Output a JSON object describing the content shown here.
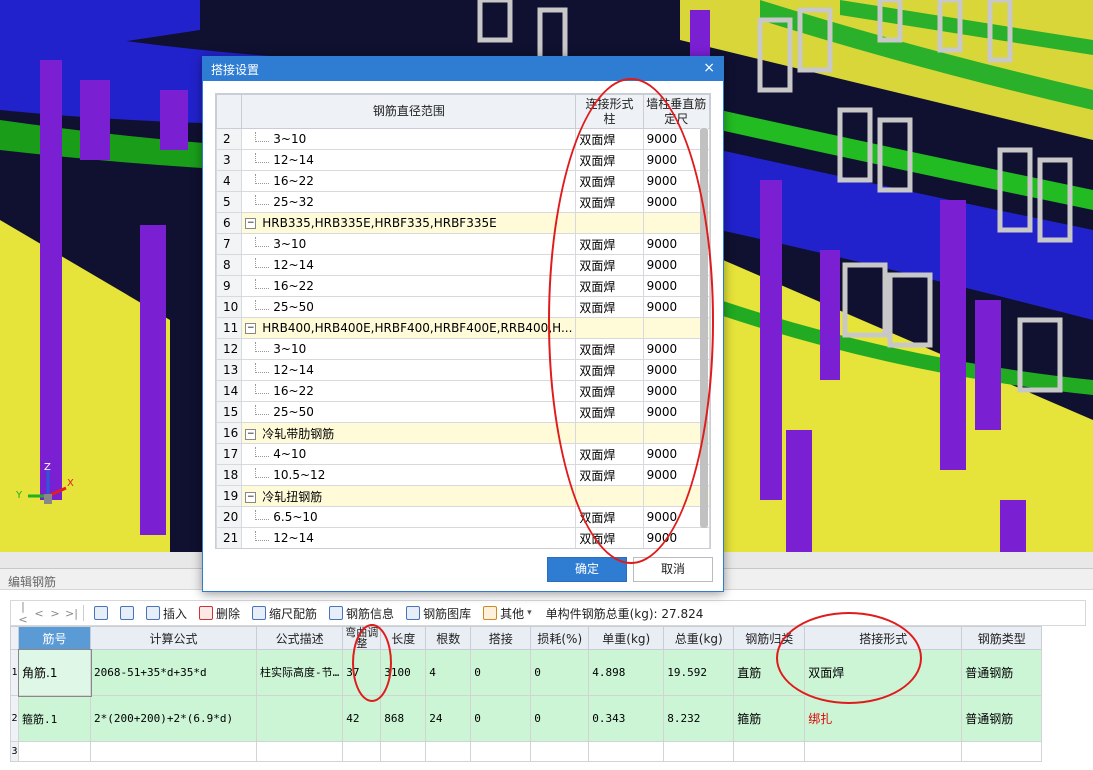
{
  "dialog": {
    "title": "搭接设置",
    "close_glyph": "×",
    "headers": {
      "range": "钢筋直径范围",
      "connection": "连接形式\n柱",
      "fixed_length": "墙柱垂直筋\n定尺"
    },
    "rows": [
      {
        "no": "2",
        "range": "3~10",
        "type": "child",
        "connection": "双面焊",
        "length": "9000"
      },
      {
        "no": "3",
        "range": "12~14",
        "type": "child",
        "connection": "双面焊",
        "length": "9000"
      },
      {
        "no": "4",
        "range": "16~22",
        "type": "child",
        "connection": "双面焊",
        "length": "9000"
      },
      {
        "no": "5",
        "range": "25~32",
        "type": "child",
        "connection": "双面焊",
        "length": "9000"
      },
      {
        "no": "6",
        "range": "HRB335,HRB335E,HRBF335,HRBF335E",
        "type": "group",
        "connection": "",
        "length": ""
      },
      {
        "no": "7",
        "range": "3~10",
        "type": "child",
        "connection": "双面焊",
        "length": "9000"
      },
      {
        "no": "8",
        "range": "12~14",
        "type": "child",
        "connection": "双面焊",
        "length": "9000"
      },
      {
        "no": "9",
        "range": "16~22",
        "type": "child",
        "connection": "双面焊",
        "length": "9000"
      },
      {
        "no": "10",
        "range": "25~50",
        "type": "child",
        "connection": "双面焊",
        "length": "9000"
      },
      {
        "no": "11",
        "range": "HRB400,HRB400E,HRBF400,HRBF400E,RRB400,H...",
        "type": "group",
        "connection": "",
        "length": ""
      },
      {
        "no": "12",
        "range": "3~10",
        "type": "child",
        "connection": "双面焊",
        "length": "9000"
      },
      {
        "no": "13",
        "range": "12~14",
        "type": "child",
        "connection": "双面焊",
        "length": "9000"
      },
      {
        "no": "14",
        "range": "16~22",
        "type": "child",
        "connection": "双面焊",
        "length": "9000"
      },
      {
        "no": "15",
        "range": "25~50",
        "type": "child",
        "connection": "双面焊",
        "length": "9000"
      },
      {
        "no": "16",
        "range": "冷轧带肋钢筋",
        "type": "group",
        "connection": "",
        "length": ""
      },
      {
        "no": "17",
        "range": "4~10",
        "type": "child",
        "connection": "双面焊",
        "length": "9000"
      },
      {
        "no": "18",
        "range": "10.5~12",
        "type": "child",
        "connection": "双面焊",
        "length": "9000"
      },
      {
        "no": "19",
        "range": "冷轧扭钢筋",
        "type": "group",
        "connection": "",
        "length": ""
      },
      {
        "no": "20",
        "range": "6.5~10",
        "type": "child",
        "connection": "双面焊",
        "length": "9000"
      },
      {
        "no": "21",
        "range": "12~14",
        "type": "child",
        "connection": "双面焊",
        "length": "9000"
      }
    ],
    "ok_label": "确定",
    "cancel_label": "取消"
  },
  "editor": {
    "title": "编辑钢筋",
    "toolbar": {
      "nav": [
        "|<",
        "<",
        ">",
        ">|"
      ],
      "insert": "插入",
      "delete": "删除",
      "scale_rebar": "缩尺配筋",
      "rebar_info": "钢筋信息",
      "rebar_library": "钢筋图库",
      "other": "其他",
      "summary": "单构件钢筋总重(kg): 27.824"
    },
    "columns": [
      "筋号",
      "计算公式",
      "公式描述",
      "弯曲调整",
      "长度",
      "根数",
      "搭接",
      "损耗(%)",
      "单重(kg)",
      "总重(kg)",
      "钢筋归类",
      "搭接形式",
      "钢筋类型"
    ],
    "rows": [
      {
        "row_no": "1",
        "bar_no": "角筋.1",
        "formula": "2068-51+35*d+35*d",
        "desc": "柱实际高度-节…",
        "bend": "37",
        "length": "3100",
        "count": "4",
        "lap": "0",
        "loss": "0",
        "unit_weight": "4.898",
        "total_weight": "19.592",
        "category": "直筋",
        "lap_form": "双面焊",
        "rebar_type": "普通钢筋"
      },
      {
        "row_no": "2",
        "bar_no": "箍筋.1",
        "formula": "2*(200+200)+2*(6.9*d)",
        "desc": "",
        "bend": "42",
        "length": "868",
        "count": "24",
        "lap": "0",
        "loss": "0",
        "unit_weight": "0.343",
        "total_weight": "8.232",
        "category": "箍筋",
        "lap_form": "绑扎",
        "rebar_type": "普通钢筋"
      },
      {
        "row_no": "3"
      }
    ]
  },
  "viewport": {
    "axis_labels": {
      "x": "X",
      "y": "Y",
      "z": "Z"
    }
  },
  "colors": {
    "accent": "#2f7cd3",
    "annotation": "#e01b1b",
    "row_green": "#ccf5d6",
    "group_yellow": "#fffbd9"
  }
}
